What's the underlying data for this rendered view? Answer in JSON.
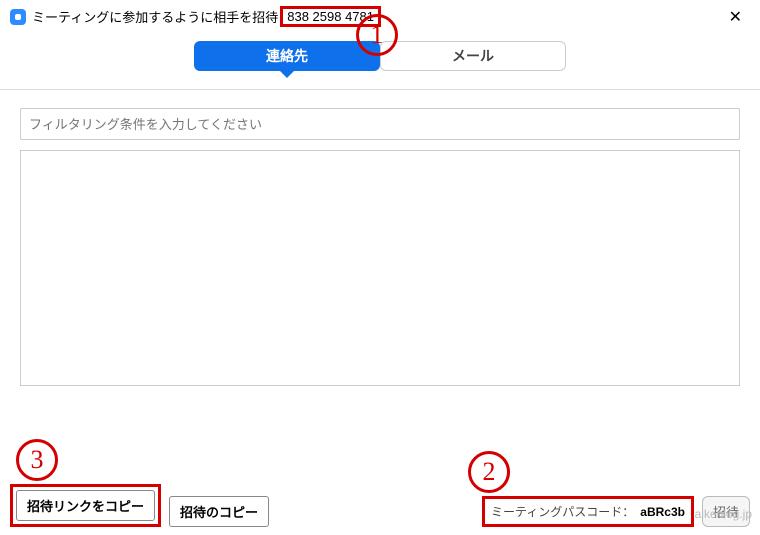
{
  "titlebar": {
    "text_prefix": "ミーティングに参加するように相手を招待",
    "meeting_id": "838 2598 4781",
    "close": "✕"
  },
  "tabs": {
    "contacts": "連絡先",
    "mail": "メール"
  },
  "filter": {
    "placeholder": "フィルタリング条件を入力してください"
  },
  "footer": {
    "copy_link": "招待リンクをコピー",
    "copy_invite": "招待のコピー",
    "passcode_label": "ミーティングパスコード：",
    "passcode_value": "aBRc3b",
    "invite": "招待"
  },
  "annotations": {
    "a1": "1",
    "a2": "2",
    "a3": "3"
  },
  "watermark": "aikenlog.jp"
}
